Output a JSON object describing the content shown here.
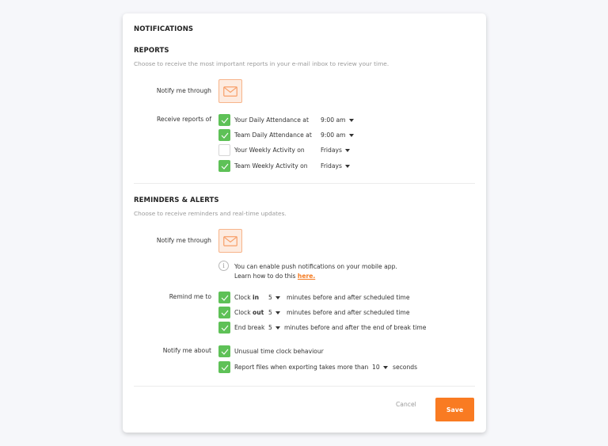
{
  "title": "NOTIFICATIONS",
  "reports": {
    "heading": "REPORTS",
    "description": "Choose to receive the most important reports in your e-mail inbox to review your time.",
    "notify_label": "Notify me through",
    "notify_channel": "email-icon",
    "receive_label": "Receive reports of",
    "items": [
      {
        "label": "Your Daily Attendance at",
        "checked": true,
        "value": "9:00 am"
      },
      {
        "label": "Team Daily Attendance at",
        "checked": true,
        "value": "9:00 am"
      },
      {
        "label": "Your Weekly Activity on",
        "checked": false,
        "value": "Fridays"
      },
      {
        "label": "Team Weekly Activity on",
        "checked": true,
        "value": "Fridays"
      }
    ]
  },
  "reminders": {
    "heading": "REMINDERS & ALERTS",
    "description": "Choose to receive reminders and real-time updates.",
    "notify_label": "Notify me through",
    "notify_channel": "email-icon",
    "info_line1": "You can enable push notifications on your mobile app.",
    "info_line2": "Learn how to do this ",
    "info_link": "here.",
    "remind_label": "Remind me to",
    "remind_items": [
      {
        "prefix": "Clock ",
        "bold": "in",
        "checked": true,
        "value": "5",
        "suffix": "minutes before and after scheduled time"
      },
      {
        "prefix": "Clock ",
        "bold": "out",
        "checked": true,
        "value": "5",
        "suffix": "minutes before and after scheduled time"
      },
      {
        "prefix": "End break",
        "bold": "",
        "checked": true,
        "value": "5",
        "suffix": "minutes before and after the end of break time"
      }
    ],
    "about_label": "Notify me about",
    "about_items": [
      {
        "label": "Unusual time clock behaviour",
        "checked": true
      },
      {
        "label": "Report files when exporting takes more than",
        "checked": true,
        "value": "10",
        "suffix": "seconds"
      }
    ]
  },
  "footer": {
    "cancel_label": "Cancel",
    "save_label": "Save"
  },
  "colors": {
    "accent": "#f97b22",
    "check": "#5ec157"
  }
}
